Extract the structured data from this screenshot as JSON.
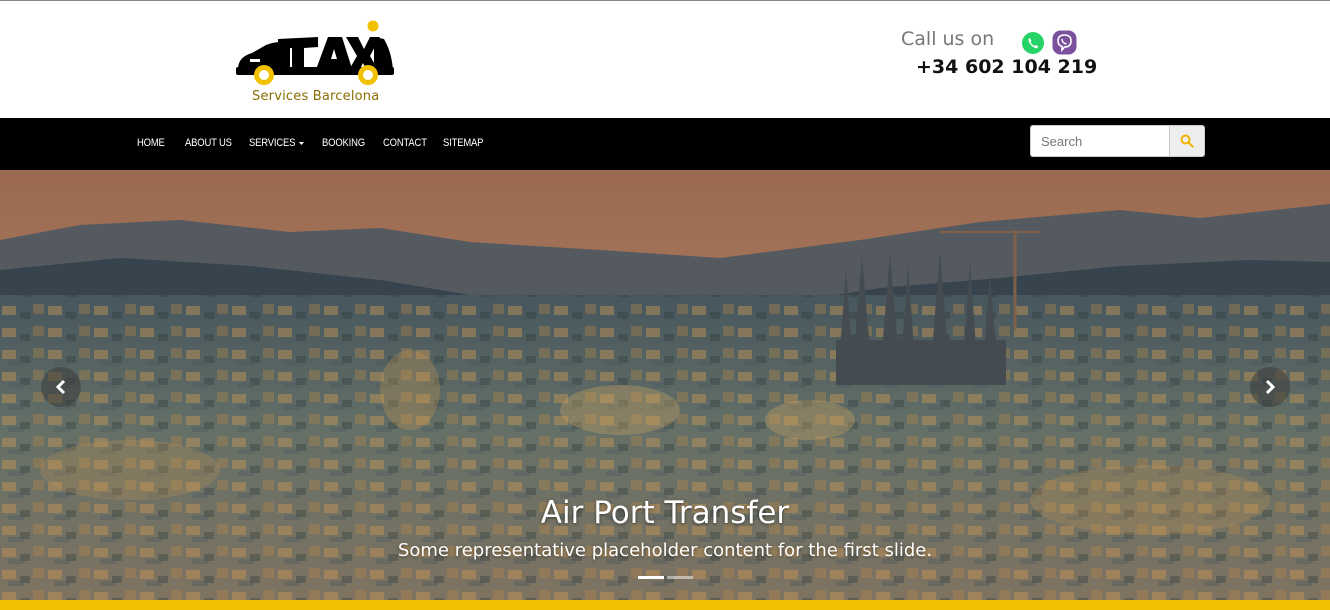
{
  "brand": {
    "logo_name": "taxi-logo",
    "logo_text": "TAXI",
    "tagline": "Services Barcelona",
    "accent_color": "#f2c200"
  },
  "contact": {
    "call_label": "Call us on",
    "phone": "+34 602 104 219",
    "icons": [
      "whatsapp-icon",
      "viber-icon"
    ]
  },
  "nav": {
    "items": [
      {
        "label": "HOME"
      },
      {
        "label": "ABOUT US"
      },
      {
        "label": "SERVICES",
        "dropdown": true
      },
      {
        "label": "BOOKING"
      },
      {
        "label": "CONTACT"
      },
      {
        "label": "SITEMAP"
      }
    ]
  },
  "search": {
    "placeholder": "Search",
    "value": ""
  },
  "carousel": {
    "slide_title": "Air Port Transfer",
    "slide_text": "Some representative placeholder content for the first slide.",
    "slide_count": 2,
    "active_slide": 1
  }
}
